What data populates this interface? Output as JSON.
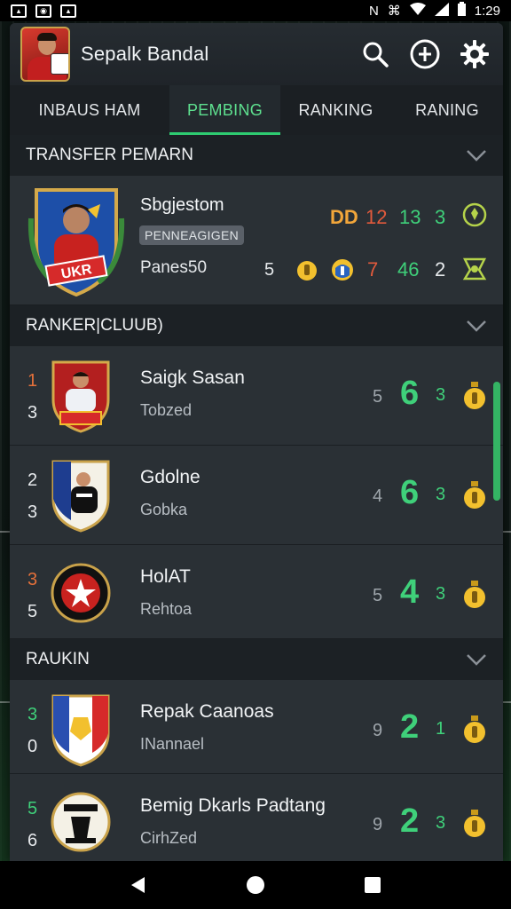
{
  "status_bar": {
    "time": "1:29",
    "left_icons": [
      "image-icon",
      "camera-icon",
      "photo-icon"
    ],
    "right_icons": [
      "nfc-icon",
      "vibrate-icon",
      "wifi-icon",
      "signal-icon",
      "battery-icon"
    ]
  },
  "header": {
    "title": "Sepalk Bandal",
    "actions": [
      "search-icon",
      "add-circle-icon",
      "settings-icon"
    ]
  },
  "tabs": [
    {
      "label": "INBAUS  HAM",
      "active": false
    },
    {
      "label": "PEMBING",
      "active": true
    },
    {
      "label": "RANKING",
      "active": false
    },
    {
      "label": "RANING",
      "active": false
    }
  ],
  "transfer_section": {
    "title": "TRANSFER PEMARN",
    "card": {
      "name": "Sbgjestom",
      "badge": "PENNEAGIGEN",
      "sub": "Panes50",
      "crest_text": "UKR",
      "top_stats": [
        "DD",
        "12",
        "13",
        "3"
      ],
      "bottom_stats": [
        "5",
        "7",
        "46",
        "2"
      ]
    }
  },
  "ranker_section": {
    "title": "RANKER|CLUUB)",
    "rows": [
      {
        "rank_a": "1",
        "rank_b": "3",
        "name": "Saigk Sasan",
        "sub": "Tobzed",
        "small": "5",
        "big": "6",
        "tiny": "3",
        "rank_color": "#e4703a"
      },
      {
        "rank_a": "2",
        "rank_b": "3",
        "name": "Gdolne",
        "sub": "Gobka",
        "small": "4",
        "big": "6",
        "tiny": "3",
        "rank_color": "#e6e9ec"
      },
      {
        "rank_a": "3",
        "rank_b": "5",
        "name": "HolAT",
        "sub": "Rehtoa",
        "small": "5",
        "big": "4",
        "tiny": "3",
        "rank_color": "#e4703a"
      }
    ]
  },
  "raukin_section": {
    "title": "RAUKIN",
    "rows": [
      {
        "rank_a": "3",
        "rank_b": "0",
        "name": "Repak Caanoas",
        "sub": "INannael",
        "small": "9",
        "big": "2",
        "tiny": "1",
        "rank_color": "#3fd07a"
      },
      {
        "rank_a": "5",
        "rank_b": "6",
        "name": "Bemig Dkarls Padtang",
        "sub": "CirhZed",
        "small": "9",
        "big": "2",
        "tiny": "3",
        "rank_color": "#3fd07a"
      }
    ]
  },
  "nav": [
    "back-icon",
    "home-icon",
    "recents-icon"
  ]
}
